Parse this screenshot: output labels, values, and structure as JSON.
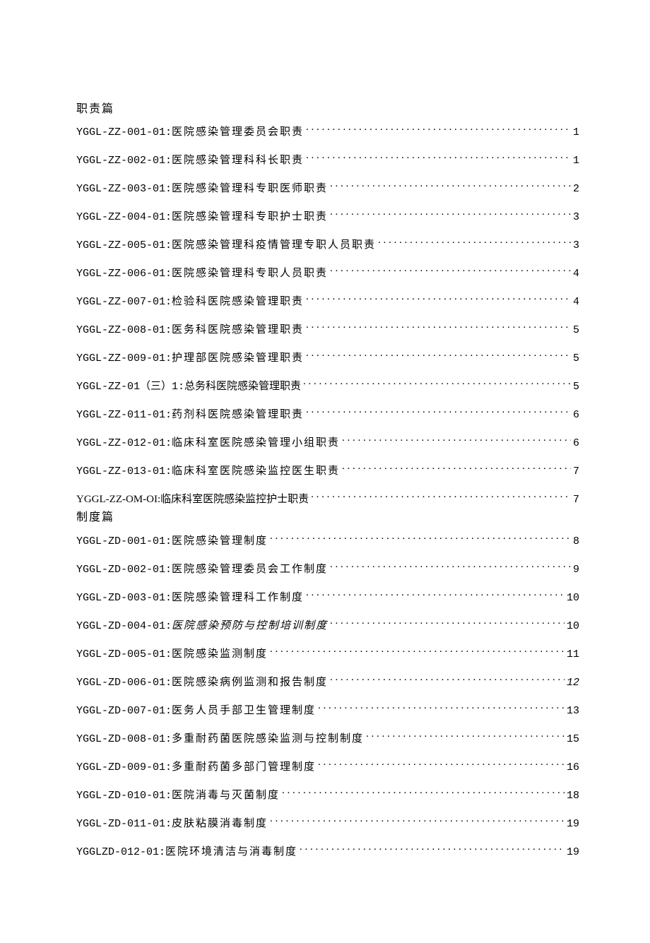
{
  "sections": [
    {
      "title": "职责篇"
    },
    {
      "title": "制度篇"
    }
  ],
  "toc_zz": [
    {
      "code": "YGGL-ZZ-001-01:",
      "title": "医院感染管理委员会职责",
      "page": "1"
    },
    {
      "code": "YGGL-ZZ-002-01:",
      "title": "医院感染管理科科长职责",
      "page": "1"
    },
    {
      "code": "YGGL-ZZ-003-01:",
      "title": "医院感染管理科专职医师职责",
      "page": "2"
    },
    {
      "code": "YGGL-ZZ-004-01:",
      "title": "医院感染管理科专职护士职责",
      "page": "3"
    },
    {
      "code": "YGGL-ZZ-005-01:",
      "title": "医院感染管理科疫情管理专职人员职责",
      "page": "3"
    },
    {
      "code": "YGGL-ZZ-006-01:",
      "title": "医院感染管理科专职人员职责",
      "page": "4"
    },
    {
      "code": "YGGL-ZZ-007-01:",
      "title": "检验科医院感染管理职责",
      "page": "4"
    },
    {
      "code": "YGGL-ZZ-008-01:",
      "title": "医务科医院感染管理职责",
      "page": "5"
    },
    {
      "code": "YGGL-ZZ-009-01:",
      "title": "护理部医院感染管理职责",
      "page": "5"
    },
    {
      "code": "YGGL-ZZ-01（三）1:",
      "title": "总务科医院感染管理职责",
      "page": "5",
      "nospace": true
    },
    {
      "code": "YGGL-ZZ-011-01:",
      "title": "药剂科医院感染管理职责",
      "page": "6"
    },
    {
      "code": "YGGL-ZZ-012-01:",
      "title": "临床科室医院感染管理小组职责",
      "page": "6"
    },
    {
      "code": "YGGL-ZZ-013-01:",
      "title": "临床科室医院感染监控医生职责",
      "page": "7"
    },
    {
      "code": "YGGL-ZZ-OM-OI:",
      "title": "临床科室医院感染监控护士职责",
      "page": "7",
      "serif": true,
      "nospace": true,
      "tight": true
    }
  ],
  "toc_zd": [
    {
      "code": "YGGL-ZD-001-01:",
      "title": "医院感染管理制度",
      "page": "8"
    },
    {
      "code": "YGGL-ZD-002-01:",
      "title": "医院感染管理委员会工作制度",
      "page": "9"
    },
    {
      "code": "YGGL-ZD-003-01:",
      "title": "医院感染管理科工作制度",
      "page": "10"
    },
    {
      "code": "YGGL-ZD-004-01:",
      "title": "医院感染预防与控制培训制度",
      "page": "10",
      "txtitalic": true
    },
    {
      "code": "YGGL-ZD-005-01:",
      "title": "医院感染监测制度",
      "page": "11"
    },
    {
      "code": "YGGL-ZD-006-01:",
      "title": "医院感染病例监测和报告制度",
      "page": "12",
      "italic": true
    },
    {
      "code": "YGGL-ZD-007-01:",
      "title": "医务人员手部卫生管理制度",
      "page": "13"
    },
    {
      "code": "YGGL-ZD-008-01:",
      "title": "多重耐药菌医院感染监测与控制制度",
      "page": "15"
    },
    {
      "code": "YGGL-ZD-009-01:",
      "title": "多重耐药菌多部门管理制度",
      "page": "16"
    },
    {
      "code": "YGGL-ZD-010-01:",
      "title": "医院消毒与灭菌制度",
      "page": "18"
    },
    {
      "code": "YGGL-ZD-011-01:",
      "title": "皮肤粘膜消毒制度",
      "page": "19"
    },
    {
      "code": "YGGLZD-012-01:",
      "title": "医院环境清洁与消毒制度",
      "page": "19"
    }
  ]
}
